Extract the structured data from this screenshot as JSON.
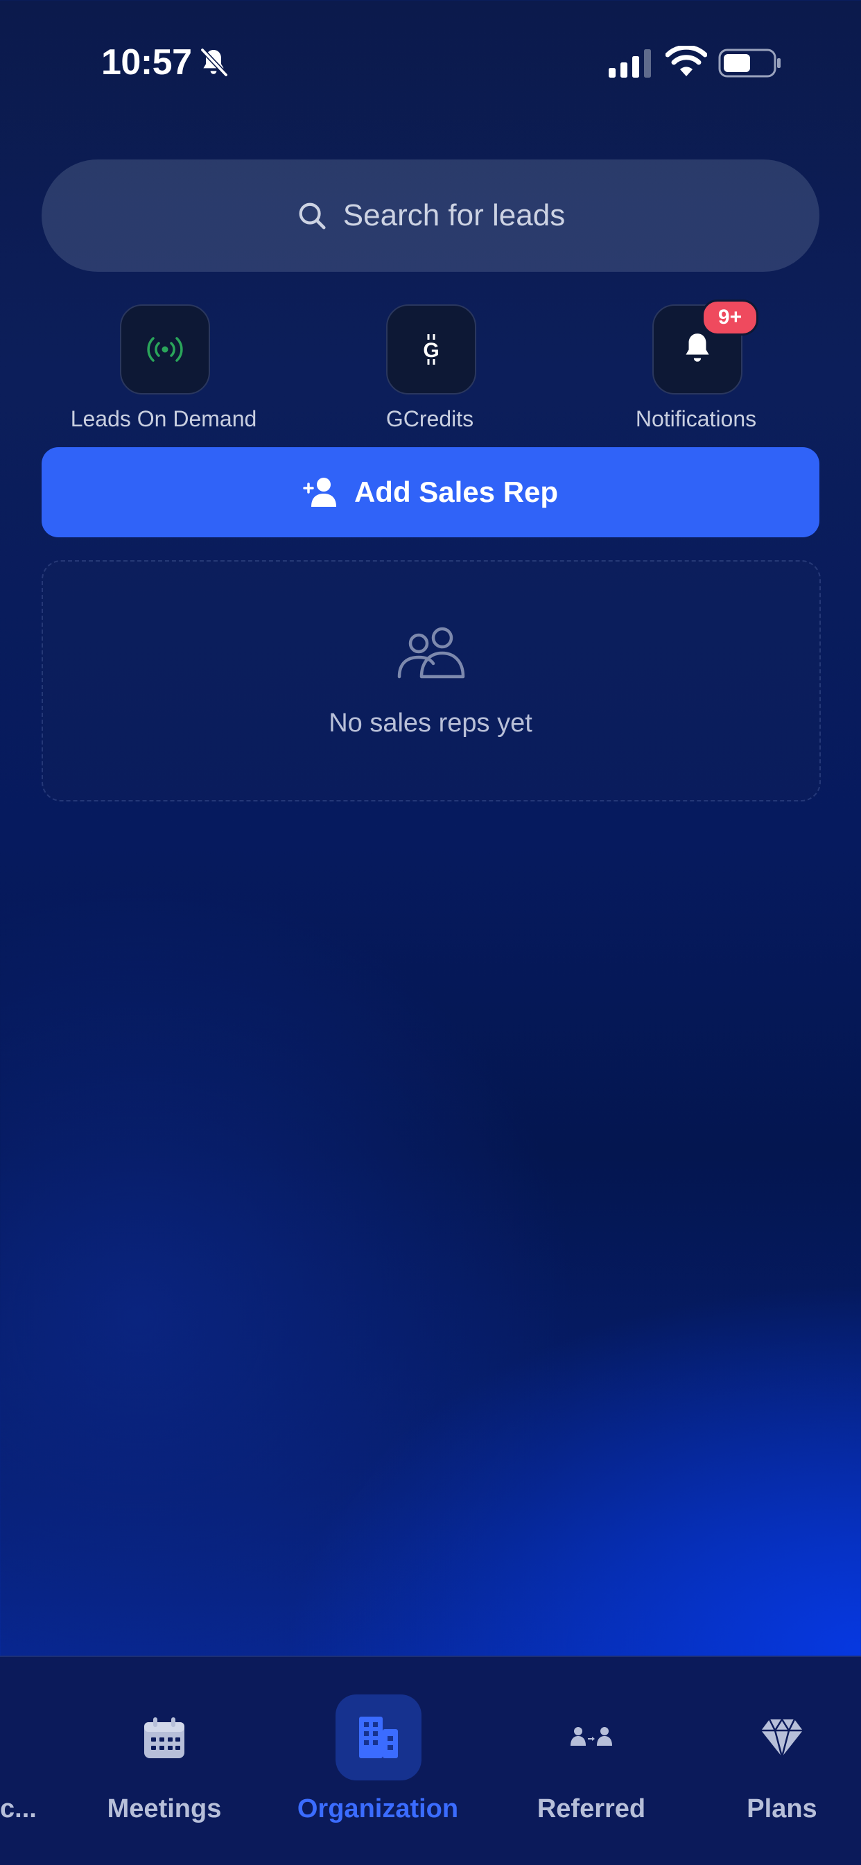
{
  "status_bar": {
    "time": "10:57"
  },
  "search": {
    "placeholder": "Search for leads"
  },
  "quick_actions": [
    {
      "label": "Leads On Demand",
      "icon": "broadcast-icon"
    },
    {
      "label": "GCredits",
      "icon": "gcredits-icon"
    },
    {
      "label": "Notifications",
      "icon": "bell-icon",
      "badge": "9+"
    }
  ],
  "add_rep_button": {
    "label": "Add Sales Rep"
  },
  "empty_state": {
    "message": "No sales reps yet"
  },
  "tabs": [
    {
      "label": "c...",
      "icon": "",
      "active": false
    },
    {
      "label": "Meetings",
      "icon": "calendar-icon",
      "active": false
    },
    {
      "label": "Organization",
      "icon": "building-icon",
      "active": true
    },
    {
      "label": "Referred",
      "icon": "referral-icon",
      "active": false
    },
    {
      "label": "Plans",
      "icon": "diamond-icon",
      "active": false
    }
  ],
  "colors": {
    "accent": "#3063f8",
    "active_tab": "#3b6cff",
    "badge": "#ef4a5e",
    "leads_icon": "#2aa55a"
  }
}
